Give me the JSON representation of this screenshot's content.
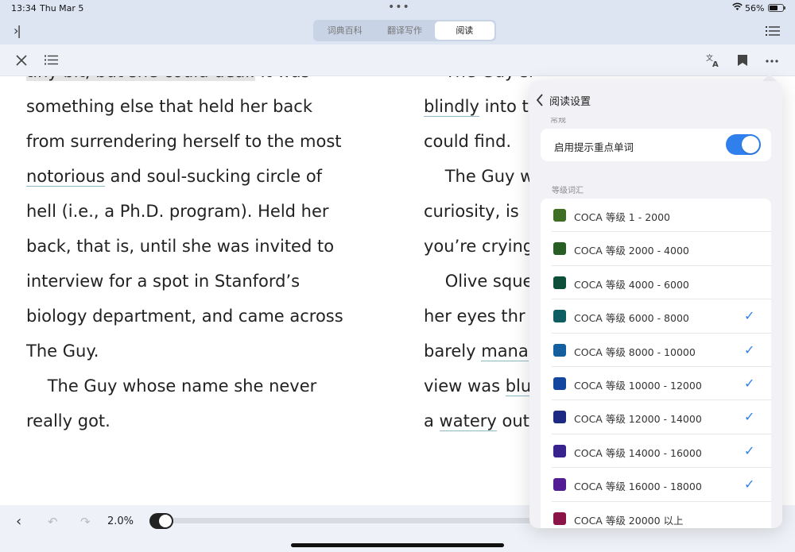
{
  "status_bar": {
    "time": "13:34",
    "date": "Thu Mar 5",
    "dots": "•••",
    "wifi_icon": "wifi-icon",
    "battery_percent": "56%",
    "battery_level": 0.56
  },
  "app_bar": {
    "tabs": [
      {
        "label": "词典百科",
        "active": false
      },
      {
        "label": "翻译写作",
        "active": false
      },
      {
        "label": "阅读",
        "active": true
      }
    ]
  },
  "reader_toolbar": {
    "icons": [
      "close-icon",
      "list-icon",
      "translate-icon",
      "bookmark-icon",
      "more-icon"
    ]
  },
  "page_left": [
    [
      {
        "t": "tiny bit, but she could deal.",
        "s": "hl"
      },
      {
        "t": " It was"
      }
    ],
    [
      {
        "t": "something else that held her back"
      }
    ],
    [
      {
        "t": "from surrendering herself to the most"
      }
    ],
    [
      {
        "t": "notorious",
        "s": "ul"
      },
      {
        "t": " and soul-sucking circle of"
      }
    ],
    [
      {
        "t": "hell (i.e., a Ph.D. program). Held her"
      }
    ],
    [
      {
        "t": "back, that is, until she was invited to"
      }
    ],
    [
      {
        "t": "interview for a spot in Stanford’s"
      }
    ],
    [
      {
        "t": "biology department, and came across"
      }
    ],
    [
      {
        "t": "The Guy."
      }
    ],
    [
      {
        "t": "    The Guy whose name she never"
      }
    ],
    [
      {
        "t": "really got."
      }
    ]
  ],
  "page_right": [
    [
      {
        "t": "    The Guy she met after stumbling"
      }
    ],
    [
      {
        "t": "blindly",
        "s": "ul"
      },
      {
        "t": " into t"
      }
    ],
    [
      {
        "t": "could find."
      }
    ],
    [
      {
        "t": "    The Guy w"
      }
    ],
    [
      {
        "t": "curiosity, is"
      }
    ],
    [
      {
        "t": "you’re crying"
      }
    ],
    [
      {
        "t": "    Olive sque"
      }
    ],
    [
      {
        "t": "her eyes thr"
      }
    ],
    [
      {
        "t": "barely "
      },
      {
        "t": "mana",
        "s": "ul"
      }
    ],
    [
      {
        "t": "view was "
      },
      {
        "t": "blu",
        "s": "ul"
      }
    ],
    [
      {
        "t": "a "
      },
      {
        "t": "watery",
        "s": "ul"
      },
      {
        "t": " out"
      }
    ]
  ],
  "bottom_bar": {
    "progress_label": "2.0%",
    "progress": 0.02
  },
  "panel": {
    "title": "阅读设置",
    "section_general": "常规",
    "highlight_toggle_label": "启用提示重点单词",
    "highlight_toggle_on": true,
    "section_levels": "等级词汇",
    "levels": [
      {
        "label": "COCA 等级 1 - 2000",
        "color": "#3f6e25",
        "checked": false
      },
      {
        "label": "COCA 等级 2000 - 4000",
        "color": "#265e24",
        "checked": false
      },
      {
        "label": "COCA 等级 4000 - 6000",
        "color": "#0e4f3c",
        "checked": false
      },
      {
        "label": "COCA 等级 6000 - 8000",
        "color": "#0f5f62",
        "checked": true
      },
      {
        "label": "COCA 等级 8000 - 10000",
        "color": "#135fa0",
        "checked": true
      },
      {
        "label": "COCA 等级 10000 - 12000",
        "color": "#14469e",
        "checked": true
      },
      {
        "label": "COCA 等级 12000 - 14000",
        "color": "#1c2a82",
        "checked": true
      },
      {
        "label": "COCA 等级 14000 - 16000",
        "color": "#37228e",
        "checked": true
      },
      {
        "label": "COCA 等级 16000 - 18000",
        "color": "#521c94",
        "checked": true
      },
      {
        "label": "COCA 等级 20000 以上",
        "color": "#8a1448",
        "checked": false
      }
    ],
    "check_glyph": "✓"
  }
}
